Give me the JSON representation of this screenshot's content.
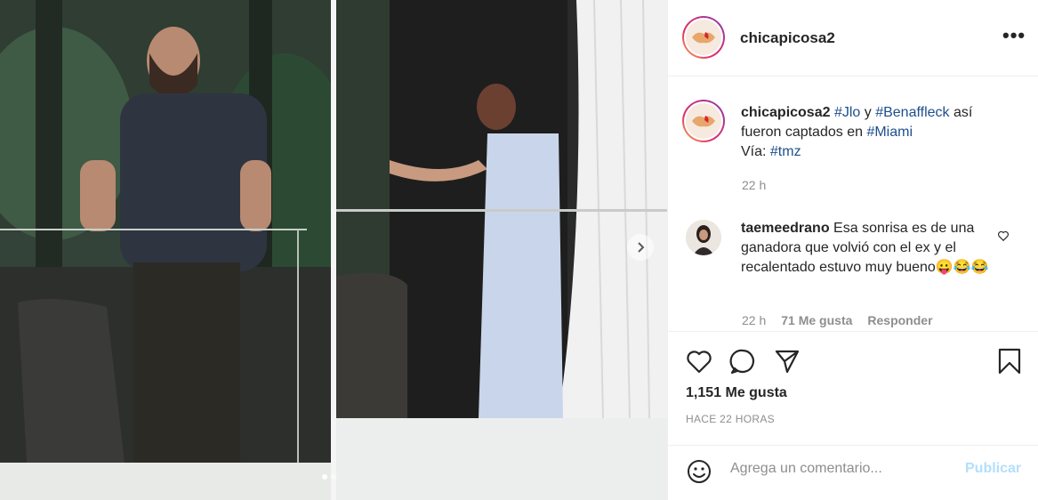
{
  "post": {
    "username": "chicapicosa2",
    "more_label": "•••",
    "caption": {
      "username": "chicapicosa2",
      "segments": [
        "#Jlo",
        " y ",
        "#Benaffleck",
        " así fueron captados en ",
        "#Miami"
      ],
      "via_label": "Vía: ",
      "via_tag": "#tmz",
      "time": "22 h"
    },
    "comment": {
      "username": "taemeedrano",
      "text": "Esa sonrisa es de una ganadora que volvió con el ex y el recalentado estuvo muy bueno",
      "emojis": "😛😂😂",
      "time": "22 h",
      "likes": "71 Me gusta",
      "reply": "Responder"
    },
    "likes": "1,151 Me gusta",
    "posted": "HACE 22 HORAS",
    "add_comment": {
      "placeholder": "Agrega un comentario...",
      "publish": "Publicar"
    }
  },
  "carousel": {
    "slides": 2,
    "active": 0
  },
  "icons": {
    "like": "heart-icon",
    "comment": "comment-icon",
    "share": "send-icon",
    "save": "bookmark-icon",
    "emoji": "emoji-icon",
    "next": "chevron-right-icon"
  },
  "colors": {
    "hashtag": "#1e4f8c",
    "publish_disabled": "#b2dffc",
    "secondary_text": "#8e8e8e"
  }
}
